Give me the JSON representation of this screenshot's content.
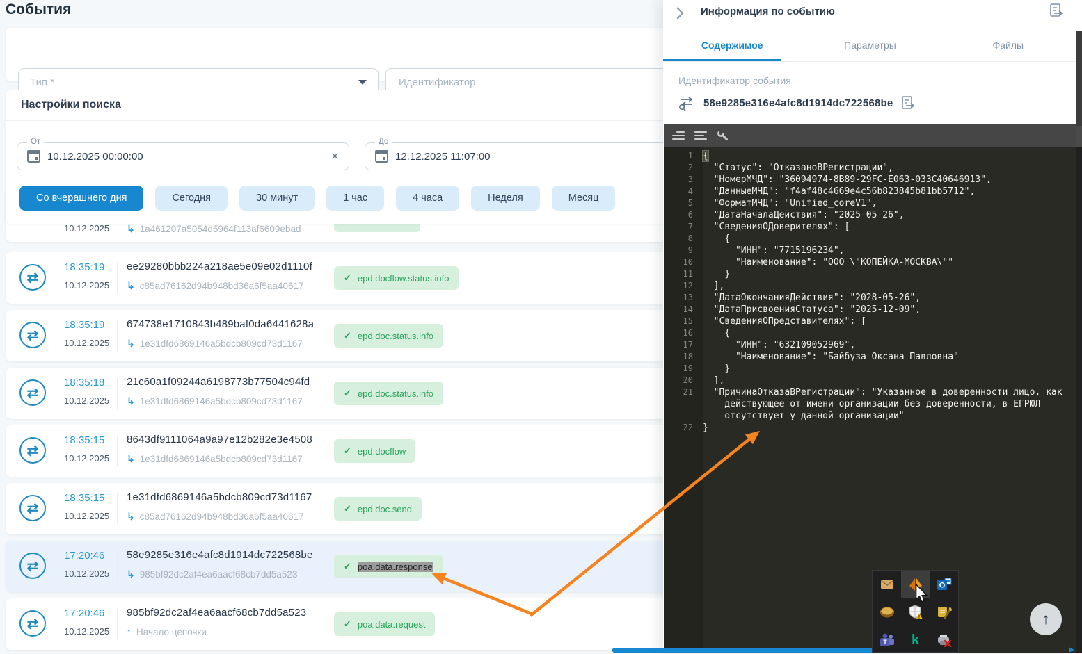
{
  "colors": {
    "accent_blue": "#1787d0",
    "time_blue": "#2499d3",
    "tag_green_bg": "#d7f0dd",
    "tag_green_text": "#27a45c",
    "selected_row_bg": "#e9f1fc",
    "editor_bg": "#2a2a24",
    "annotation_orange": "#f5831f"
  },
  "page": {
    "title": "События"
  },
  "filters": {
    "type_label": "Тип *",
    "identifier_placeholder": "Идентификатор"
  },
  "search": {
    "title": "Настройки поиска",
    "from_label": "От",
    "from_value": "10.12.2025 00:00:00",
    "to_label": "До",
    "to_value": "12.12.2025 11:07:00",
    "quick_buttons": [
      {
        "label": "Со вчерашнего дня",
        "active": true
      },
      {
        "label": "Сегодня",
        "active": false
      },
      {
        "label": "30 минут",
        "active": false
      },
      {
        "label": "1 час",
        "active": false
      },
      {
        "label": "4 часа",
        "active": false
      },
      {
        "label": "Неделя",
        "active": false
      },
      {
        "label": "Месяц",
        "active": false
      }
    ]
  },
  "events": {
    "partial": {
      "date": "10.12.2025",
      "related": "1a461207a5054d5964f113af6609ebad"
    },
    "rows": [
      {
        "time": "18:35:19",
        "date": "10.12.2025",
        "id": "ee29280bbb224a218ae5e09e02d1110f",
        "chain": "child",
        "related": "c85ad76162d94b948bd36a6f5aa40617",
        "tag": "epd.docflow.status.info",
        "selected": false,
        "tag_selected": false
      },
      {
        "time": "18:35:19",
        "date": "10.12.2025",
        "id": "674738e1710843b489baf0da6441628a",
        "chain": "child",
        "related": "1e31dfd6869146a5bdcb809cd73d1167",
        "tag": "epd.doc.status.info",
        "selected": false,
        "tag_selected": false
      },
      {
        "time": "18:35:18",
        "date": "10.12.2025",
        "id": "21c60a1f09244a6198773b77504c94fd",
        "chain": "child",
        "related": "1e31dfd6869146a5bdcb809cd73d1167",
        "tag": "epd.doc.status.info",
        "selected": false,
        "tag_selected": false
      },
      {
        "time": "18:35:15",
        "date": "10.12.2025",
        "id": "8643df9111064a9a97e12b282e3e4508",
        "chain": "child",
        "related": "1e31dfd6869146a5bdcb809cd73d1167",
        "tag": "epd.docflow",
        "selected": false,
        "tag_selected": false
      },
      {
        "time": "18:35:15",
        "date": "10.12.2025",
        "id": "1e31dfd6869146a5bdcb809cd73d1167",
        "chain": "child",
        "related": "c85ad76162d94b948bd36a6f5aa40617",
        "tag": "epd.doc.send",
        "selected": false,
        "tag_selected": false
      },
      {
        "time": "17:20:46",
        "date": "10.12.2025",
        "id": "58e9285e316e4afc8d1914dc722568be",
        "chain": "child",
        "related": "985bf92dc2af4ea6aacf68cb7dd5a523",
        "tag": "poa.data.response",
        "selected": true,
        "tag_selected": true
      },
      {
        "time": "17:20:46",
        "date": "10.12.2025",
        "id": "985bf92dc2af4ea6aacf68cb7dd5a523",
        "chain": "start",
        "related": "Начало цепочки",
        "tag": "poa.data.request",
        "selected": false,
        "tag_selected": false
      }
    ]
  },
  "panel": {
    "title": "Информация по событию",
    "tabs": [
      {
        "label": "Содержимое",
        "active": true
      },
      {
        "label": "Параметры",
        "active": false
      },
      {
        "label": "Файлы",
        "active": false
      }
    ],
    "event_id_label": "Идентификатор события",
    "event_id": "58e9285e316e4afc8d1914dc722568be"
  },
  "editor": {
    "lines": [
      {
        "n": 1,
        "t": "{",
        "hl": true
      },
      {
        "n": 2,
        "t": "  \"Статус\": \"ОтказаноВРегистрации\","
      },
      {
        "n": 3,
        "t": "  \"НомерМЧД\": \"36094974-8B89-29FC-E063-033C40646913\","
      },
      {
        "n": 4,
        "t": "  \"ДанныеМЧД\": \"f4af48c4669e4c56b823845b81bb5712\","
      },
      {
        "n": 5,
        "t": "  \"ФорматМЧД\": \"Unified_coreV1\","
      },
      {
        "n": 6,
        "t": "  \"ДатаНачалаДействия\": \"2025-05-26\","
      },
      {
        "n": 7,
        "t": "  \"СведенияОДоверителях\": ["
      },
      {
        "n": 8,
        "t": "    {"
      },
      {
        "n": 9,
        "t": "      \"ИНН\": \"7715196234\","
      },
      {
        "n": 10,
        "t": "      \"Наименование\": \"ООО \\\"КОПЕЙКА-МОСКВА\\\"\""
      },
      {
        "n": 11,
        "t": "    }"
      },
      {
        "n": 12,
        "t": "  ],"
      },
      {
        "n": 13,
        "t": "  \"ДатаОкончанияДействия\": \"2028-05-26\","
      },
      {
        "n": 14,
        "t": "  \"ДатаПрисвоенияСтатуса\": \"2025-12-09\","
      },
      {
        "n": 15,
        "t": "  \"СведенияОПредставителях\": ["
      },
      {
        "n": 16,
        "t": "    {"
      },
      {
        "n": 17,
        "t": "      \"ИНН\": \"632109052969\","
      },
      {
        "n": 18,
        "t": "      \"Наименование\": \"Байбуза Оксана Павловна\""
      },
      {
        "n": 19,
        "t": "    }"
      },
      {
        "n": 20,
        "t": "  ],"
      },
      {
        "n": 21,
        "t": "  \"ПричинаОтказаВРегистрации\": \"Указанное в доверенности лицо, как действующее от имени организации без доверенности, в ЕГРЮЛ отсутствует у данной организации\""
      },
      {
        "n": 22,
        "t": "}"
      }
    ]
  },
  "tray": {
    "icons": [
      "mail-icon",
      "orange-arrows-icon",
      "outlook-icon",
      "coin-icon",
      "defender-warning-icon",
      "certificate-edit-icon",
      "teams-icon",
      "kaspersky-icon",
      "printer-error-icon"
    ],
    "highlighted": "orange-arrows-icon",
    "kaspersky_glyph": "k"
  },
  "fab": {
    "glyph": "↑"
  }
}
